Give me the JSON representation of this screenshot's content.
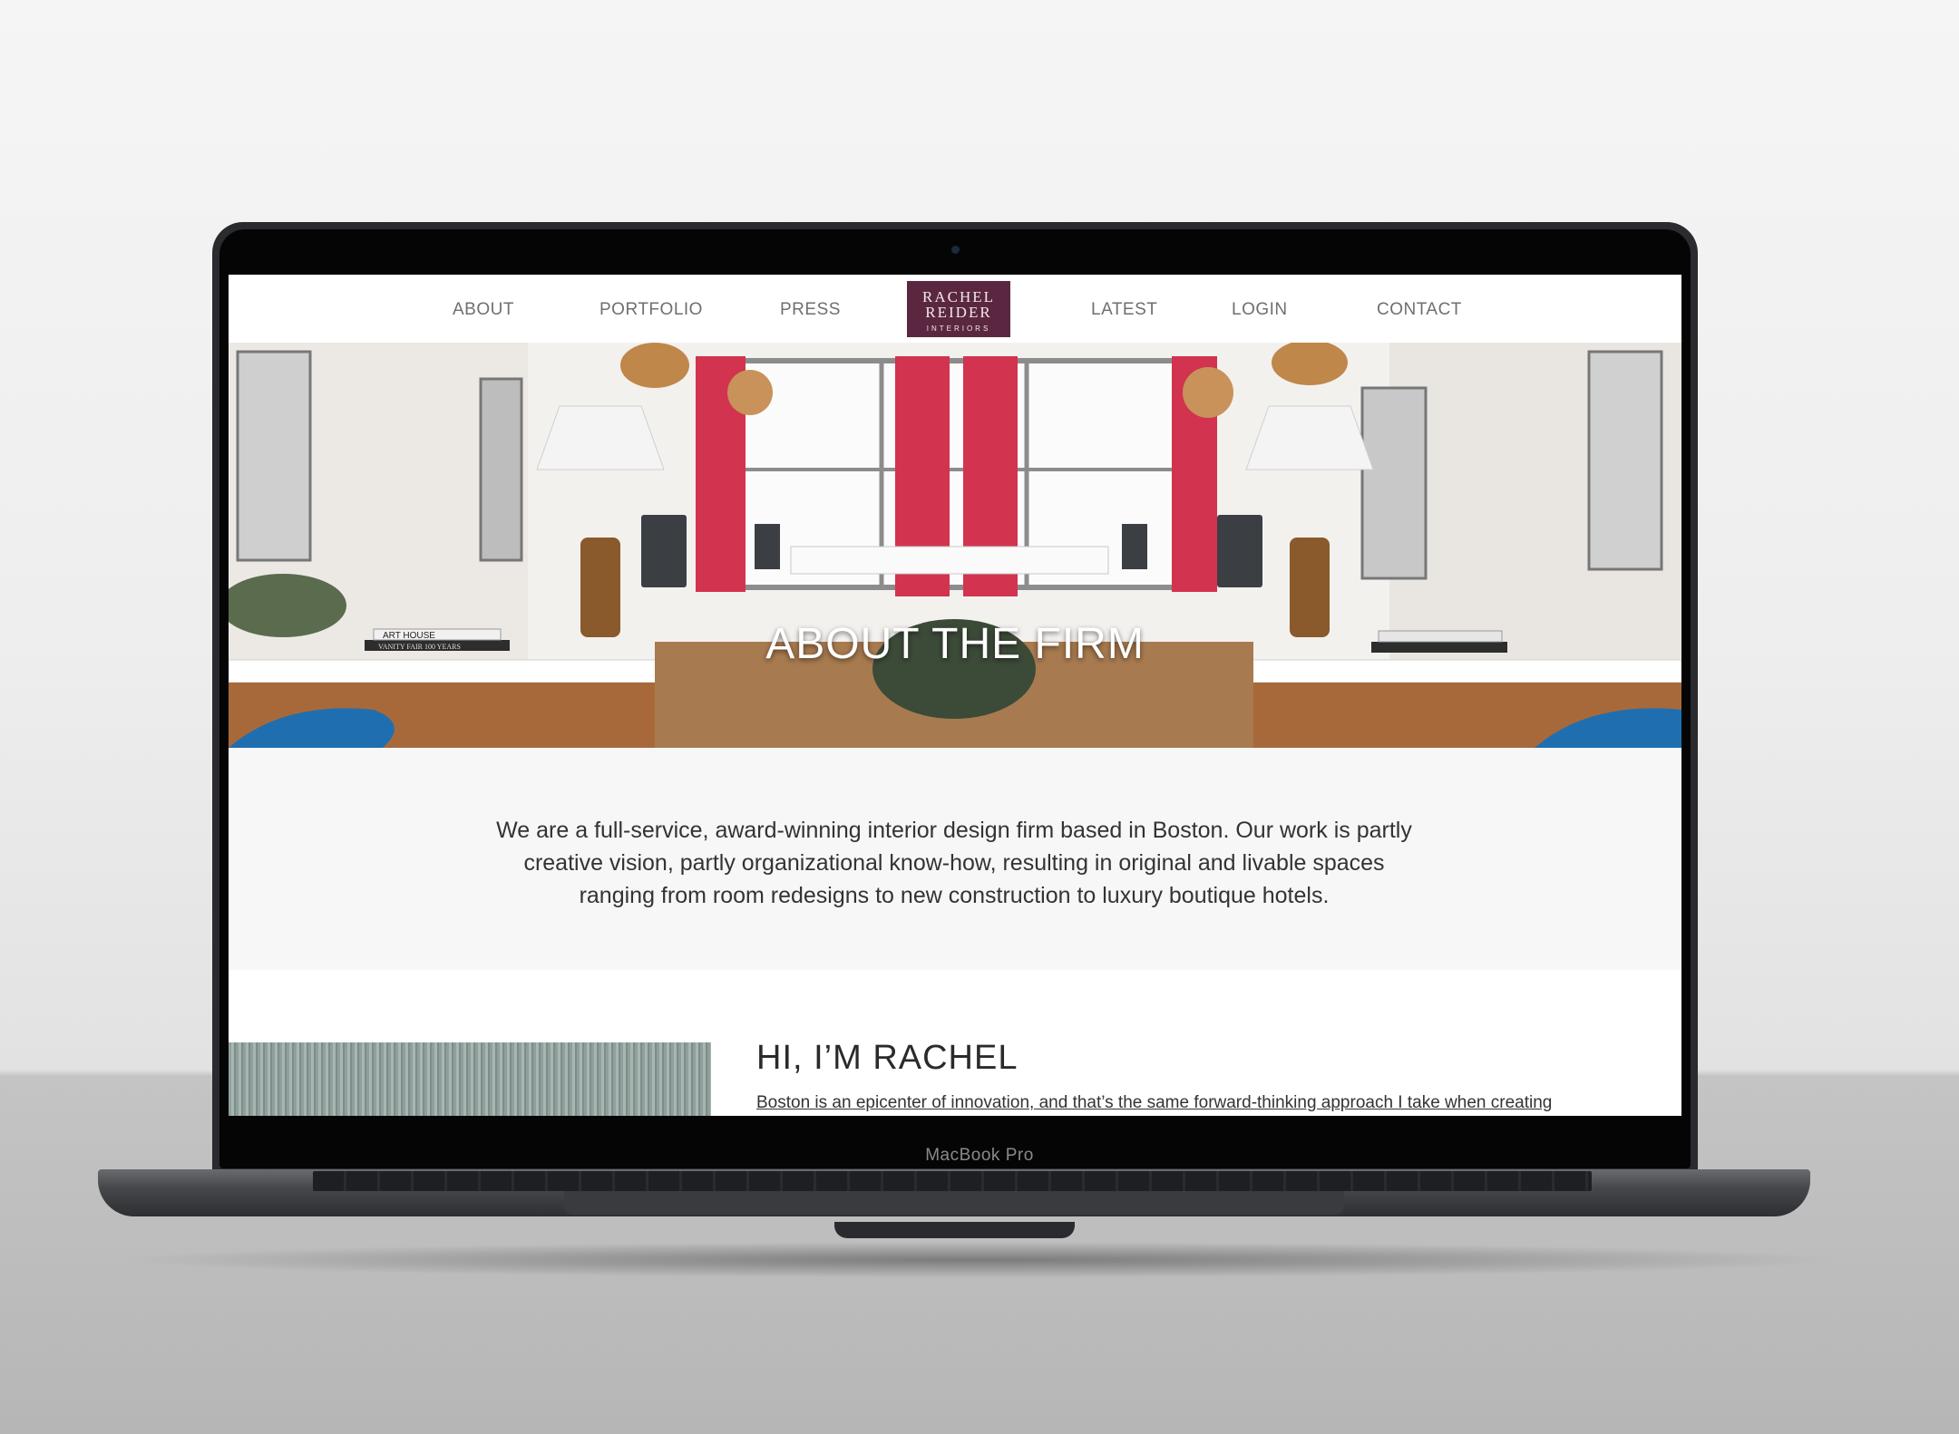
{
  "nav": {
    "left_items": [
      {
        "label": "ABOUT"
      },
      {
        "label": "PORTFOLIO"
      },
      {
        "label": "PRESS"
      }
    ],
    "right_items": [
      {
        "label": "LATEST"
      },
      {
        "label": "LOGIN"
      },
      {
        "label": "CONTACT"
      }
    ],
    "logo": {
      "line1": "RACHEL",
      "line2": "REIDER",
      "line3": "INTERIORS"
    }
  },
  "hero": {
    "title": "ABOUT THE FIRM",
    "photo_books": [
      "ART HOUSE",
      "VANITY FAIR 100 YEARS"
    ]
  },
  "intro": {
    "text": "We are a full-service, award-winning interior design firm based in Boston. Our work is partly creative vision, partly organizational know-how, resulting in original and livable spaces ranging from room redesigns to new construction to luxury boutique hotels."
  },
  "about": {
    "heading": "HI, I’M RACHEL",
    "body": "Boston is an epicenter of innovation, and that’s the same forward-thinking approach I take when creating"
  },
  "device": {
    "label": "MacBook Pro"
  },
  "colors": {
    "logo_bg": "#5b2740",
    "curtain": "#d2334e",
    "chair": "#1f6fb0"
  }
}
